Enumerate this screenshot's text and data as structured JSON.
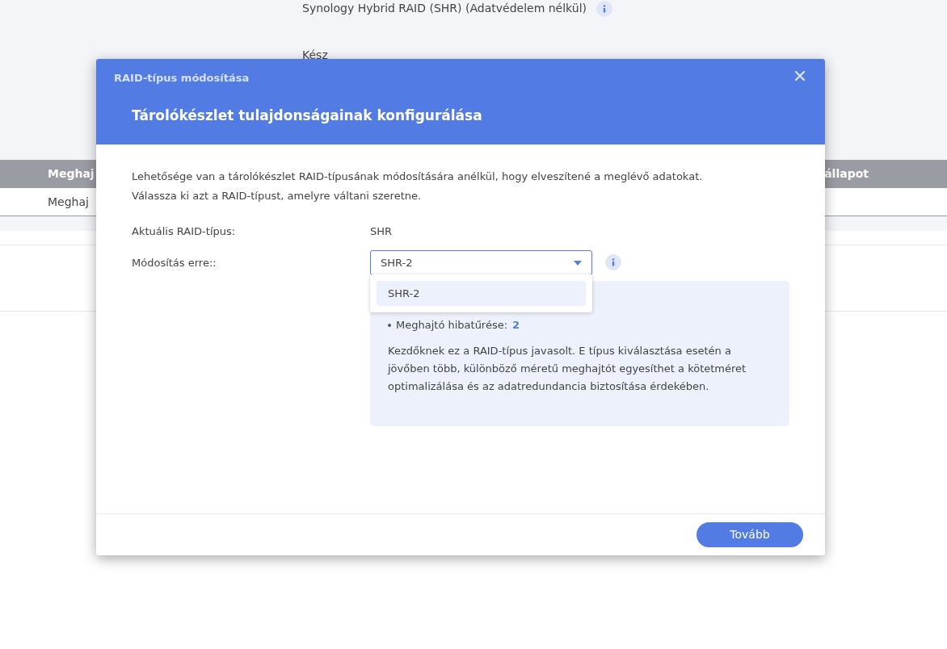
{
  "background": {
    "raid_type": "Synology Hybrid RAID (SHR) (Adatvédelem nélkül)",
    "status": "Kész",
    "table": {
      "columns": [
        "Meghaj",
        "állapot"
      ],
      "rows": [
        [
          "Meghaj"
        ]
      ]
    }
  },
  "dialog": {
    "title": "RAID-típus módosítása",
    "heading": "Tárolókészlet tulajdonságainak konfigurálása",
    "intro": [
      "Lehetősége van a tárolókészlet RAID-típusának módosítására anélkül, hogy elveszítené a meglévő adatokat.",
      "Válassza ki azt a RAID-típust, amelyre váltani szeretne."
    ],
    "current": {
      "label": "Aktuális RAID-típus:",
      "value": "SHR"
    },
    "change": {
      "label": "Módosítás erre::",
      "value": "SHR-2",
      "expanded": true,
      "options": [
        {
          "label": "SHR-2",
          "selected": true
        }
      ]
    },
    "info": {
      "fault_tolerance_label": "Meghajtó hibatűrése:",
      "fault_tolerance_value": "2",
      "description": "Kezdőknek ez a RAID-típus javasolt. E típus kiválasztása esetén a jövőben több, különböző méretű meghajtót egyesíthet a kötetméret optimalizálása és az adatredundancia biztosítása érdekében."
    },
    "next_button": "Tovább"
  }
}
